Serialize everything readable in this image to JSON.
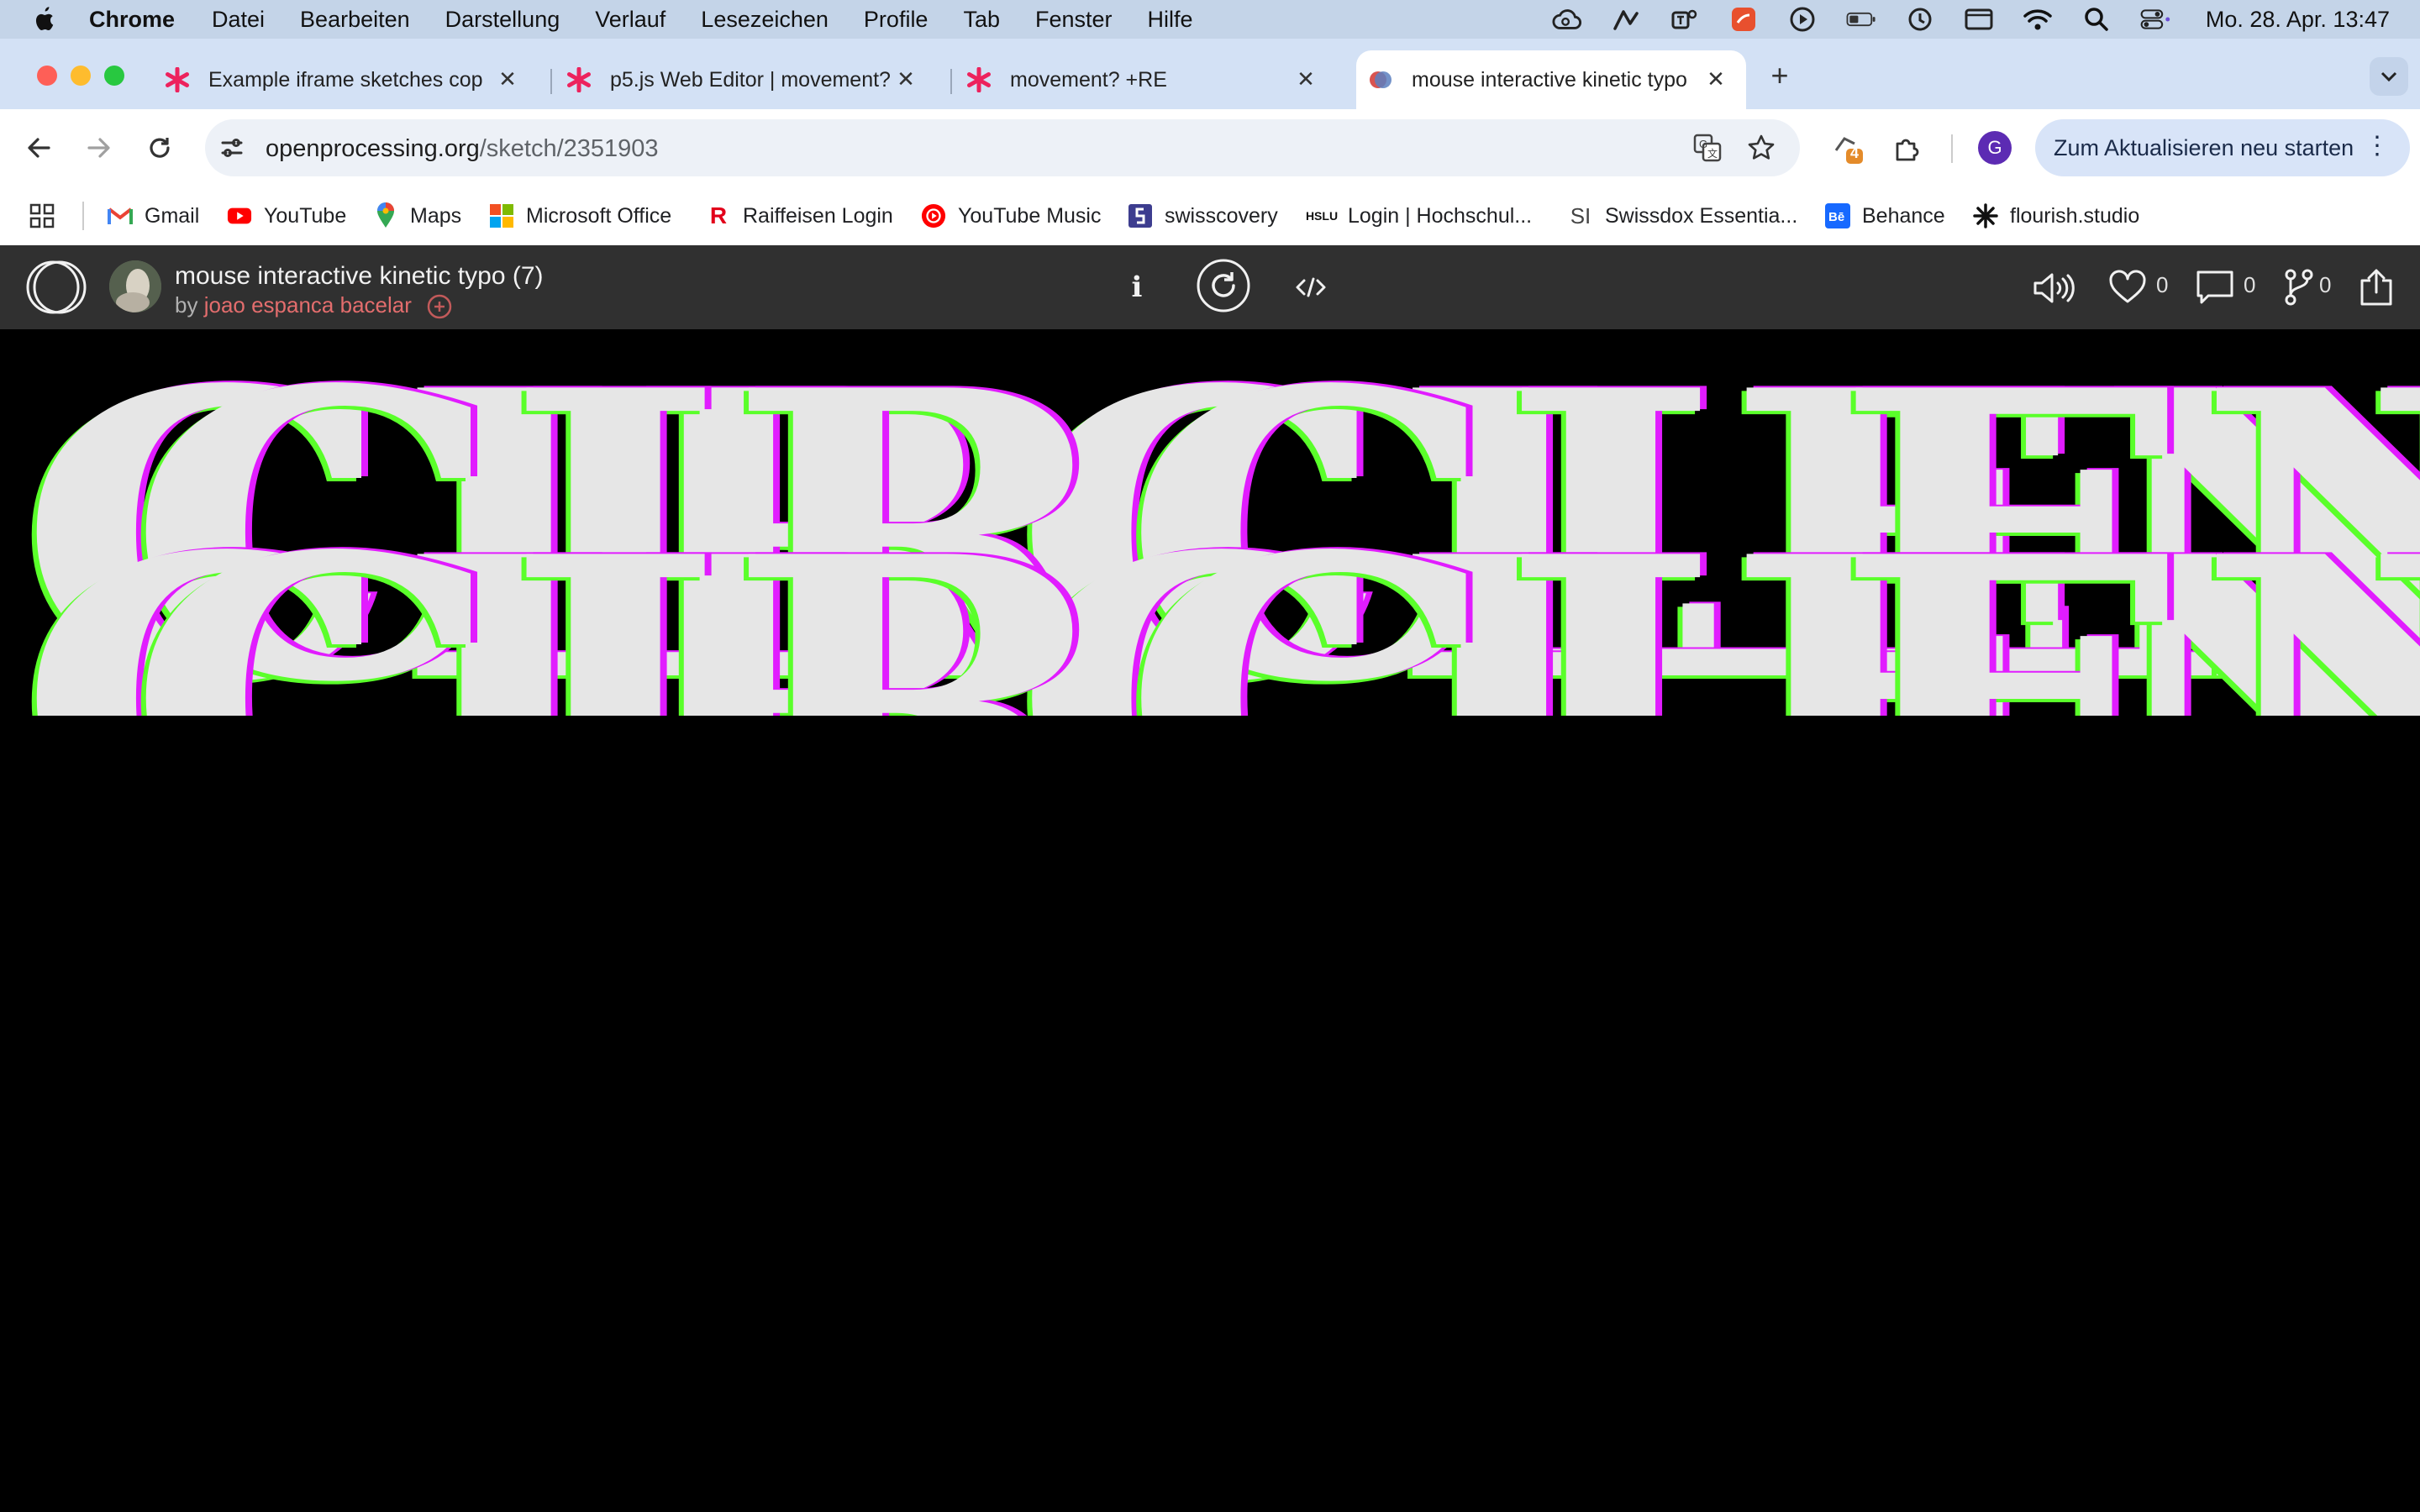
{
  "menubar": {
    "app_name": "Chrome",
    "items": [
      "Datei",
      "Bearbeiten",
      "Darstellung",
      "Verlauf",
      "Lesezeichen",
      "Profile",
      "Tab",
      "Fenster",
      "Hilfe"
    ],
    "clock": "Mo. 28. Apr.  13:47",
    "status_icons": [
      "creative-cloud-icon",
      "pen-icon",
      "teams-icon",
      "app-icon",
      "play-icon",
      "battery-icon",
      "time-machine-icon",
      "screen-icon",
      "wifi-icon",
      "search-icon",
      "control-center-icon"
    ]
  },
  "tabs": [
    {
      "title": "Example iframe sketches cop",
      "favicon": "p5-asterisk-icon",
      "active": false
    },
    {
      "title": "p5.js Web Editor | movement?",
      "favicon": "p5-asterisk-icon",
      "active": false
    },
    {
      "title": "movement? +RE",
      "favicon": "p5-asterisk-icon",
      "active": false
    },
    {
      "title": "mouse interactive kinetic typo",
      "favicon": "openprocessing-icon",
      "active": true
    }
  ],
  "toolbar": {
    "url_host": "openprocessing.org",
    "url_path": "/sketch/2351903",
    "extension_badge": "4",
    "profile_letter": "G",
    "update_label": "Zum Aktualisieren neu starten"
  },
  "bookmarks": [
    {
      "label": "Gmail",
      "icon": "gmail-icon"
    },
    {
      "label": "YouTube",
      "icon": "youtube-icon"
    },
    {
      "label": "Maps",
      "icon": "maps-icon"
    },
    {
      "label": "Microsoft Office",
      "icon": "office-icon"
    },
    {
      "label": "Raiffeisen Login",
      "icon": "raiffeisen-icon"
    },
    {
      "label": "YouTube Music",
      "icon": "youtube-music-icon"
    },
    {
      "label": "swisscovery",
      "icon": "swisscovery-icon"
    },
    {
      "label": "Login | Hochschul...",
      "icon": "hslu-icon"
    },
    {
      "label": "Swissdox Essentia...",
      "icon": "swissdox-icon"
    },
    {
      "label": "Behance",
      "icon": "behance-icon"
    },
    {
      "label": "flourish.studio",
      "icon": "flourish-icon"
    }
  ],
  "sketch": {
    "title": "mouse interactive kinetic typo (7)",
    "by": "by",
    "author": "joao espanca bacelar",
    "likes": "0",
    "comments": "0",
    "forks": "0"
  },
  "canvas": {
    "text": "CIRCLEN",
    "colors": {
      "fill": "#e6e6e6",
      "green": "#5aff2a",
      "magenta": "#e11cff",
      "blue": "#2a2aff"
    }
  }
}
